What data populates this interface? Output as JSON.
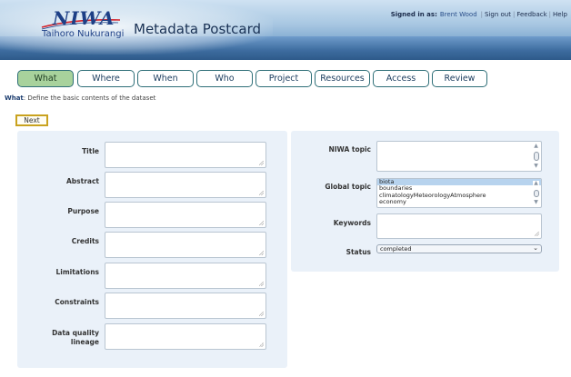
{
  "header": {
    "logo_text": "NIWA",
    "logo_subtext": "Taihoro Nukurangi",
    "app_title": "Metadata Postcard",
    "signed_in_label": "Signed in as:",
    "user_name": "Brent Wood",
    "links": [
      "Sign out",
      "Feedback",
      "Help"
    ]
  },
  "tabs": [
    {
      "label": "What",
      "active": true
    },
    {
      "label": "Where",
      "active": false
    },
    {
      "label": "When",
      "active": false
    },
    {
      "label": "Who",
      "active": false
    },
    {
      "label": "Project",
      "active": false
    },
    {
      "label": "Resources",
      "active": false
    },
    {
      "label": "Access",
      "active": false
    },
    {
      "label": "Review",
      "active": false
    }
  ],
  "intro": {
    "section": "What",
    "description": ": Define the basic contents of the dataset"
  },
  "next_label": "Next",
  "left_fields": [
    {
      "label": "Title",
      "value": ""
    },
    {
      "label": "Abstract",
      "value": ""
    },
    {
      "label": "Purpose",
      "value": ""
    },
    {
      "label": "Credits",
      "value": ""
    },
    {
      "label": "Limitations",
      "value": ""
    },
    {
      "label": "Constraints",
      "value": ""
    },
    {
      "label_line1": "Data quality",
      "label_line2": "lineage",
      "value": ""
    }
  ],
  "right_fields": {
    "niwa_topic": {
      "label": "NIWA topic",
      "value": ""
    },
    "global_topic": {
      "label": "Global topic",
      "options": [
        "biota",
        "boundaries",
        "climatologyMeteorologyAtmosphere",
        "economy"
      ],
      "selected": "biota"
    },
    "keywords": {
      "label": "Keywords",
      "value": ""
    },
    "status": {
      "label": "Status",
      "value": "completed"
    }
  },
  "colors": {
    "active_tab": "#a8d29c",
    "tab_border": "#2f6f78",
    "panel_bg": "#eaf1f9",
    "next_border": "#c9a21f",
    "selected_option": "#b7d3ee"
  }
}
